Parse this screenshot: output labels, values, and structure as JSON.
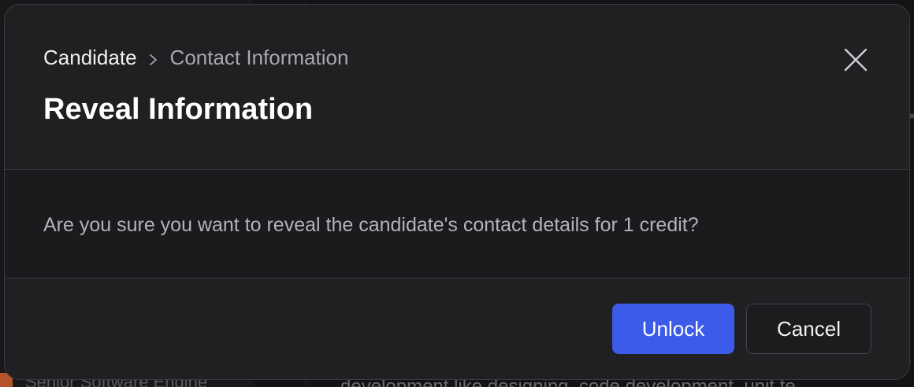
{
  "background": {
    "left_text": "Senior Software Engine",
    "right_text": "development like designing, code development, unit te"
  },
  "dialog": {
    "breadcrumb": {
      "root": "Candidate",
      "current": "Contact Information"
    },
    "title": "Reveal Information",
    "message": "Are you sure you want to reveal the candidate's contact details for 1 credit?",
    "buttons": {
      "primary": "Unlock",
      "secondary": "Cancel"
    },
    "icons": {
      "close": "close-icon",
      "separator": "chevron-right-icon"
    }
  },
  "colors": {
    "primary_button": "#3b5be8",
    "modal_bg": "#1f1f22"
  }
}
